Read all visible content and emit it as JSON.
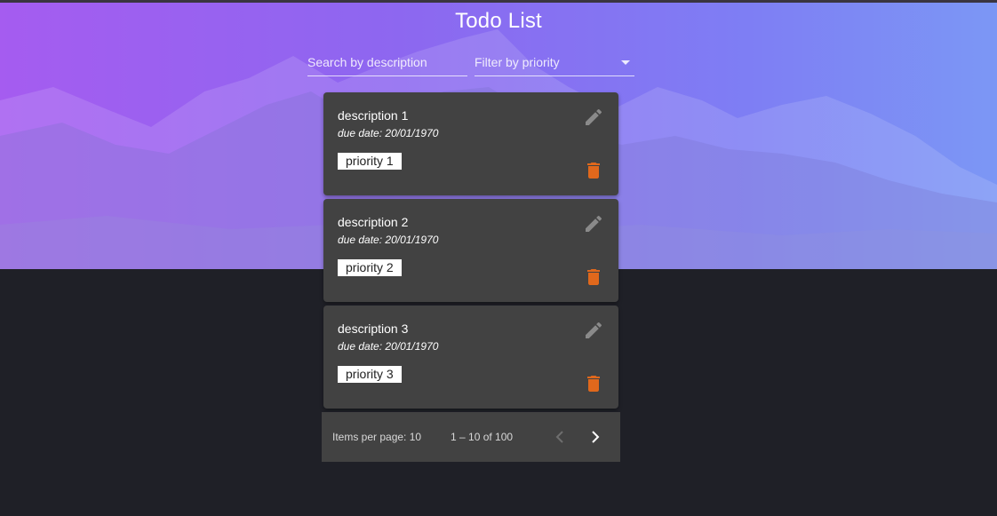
{
  "header": {
    "title": "Todo List",
    "search": {
      "placeholder": "Search by description",
      "value": ""
    },
    "filter": {
      "placeholder": "Filter by priority",
      "value": ""
    }
  },
  "todos": [
    {
      "description": "description 1",
      "due_label": "due date:",
      "due_date": "20/01/1970",
      "priority": "priority 1"
    },
    {
      "description": "description 2",
      "due_label": "due date:",
      "due_date": "20/01/1970",
      "priority": "priority 2"
    },
    {
      "description": "description 3",
      "due_label": "due date:",
      "due_date": "20/01/1970",
      "priority": "priority 3"
    }
  ],
  "paginator": {
    "items_per_page_label": "Items per page:",
    "items_per_page": "10",
    "range_label": "1 – 10 of 100"
  },
  "icons": {
    "edit": "pencil-icon",
    "delete": "trash-icon",
    "prev": "chevron-left-icon",
    "next": "chevron-right-icon"
  },
  "colors": {
    "background": "#1f2027",
    "card": "#424242",
    "delete_accent": "#e0681c",
    "edit_icon": "#8a8a8a",
    "hero_gradient_start": "#a55cf0",
    "hero_gradient_end": "#7c97f5"
  }
}
